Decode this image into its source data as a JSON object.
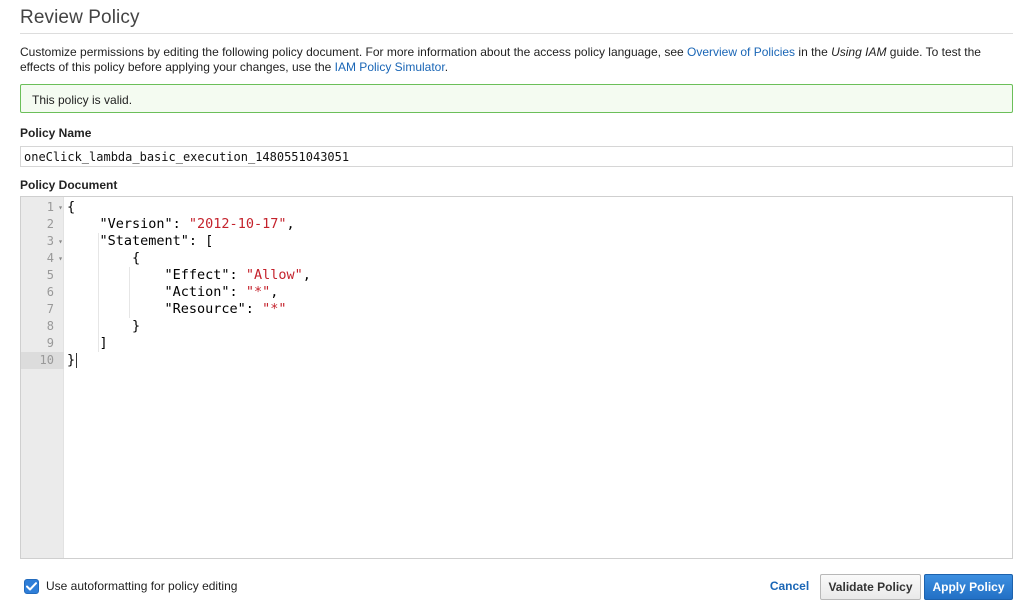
{
  "page": {
    "title": "Review Policy",
    "description": {
      "part1": "Customize permissions by editing the following policy document. For more information about the access policy language, see ",
      "link1": "Overview of Policies",
      "part2": " in the ",
      "italic": "Using IAM",
      "part3": " guide. To test the effects of this policy before applying your changes, use the ",
      "link2": "IAM Policy Simulator",
      "part4": "."
    },
    "validation_message": "This policy is valid."
  },
  "policy_name": {
    "label": "Policy Name",
    "value": "oneClick_lambda_basic_execution_1480551043051"
  },
  "policy_document": {
    "label": "Policy Document",
    "line_numbers": [
      "1",
      "2",
      "3",
      "4",
      "5",
      "6",
      "7",
      "8",
      "9",
      "10"
    ],
    "foldable_lines": [
      1,
      3,
      4
    ],
    "active_line": 10,
    "lines": [
      {
        "pre": "{",
        "str": "",
        "post": ""
      },
      {
        "pre": "    \"Version\": ",
        "str": "\"2012-10-17\"",
        "post": ","
      },
      {
        "pre": "    \"Statement\": [",
        "str": "",
        "post": ""
      },
      {
        "pre": "        {",
        "str": "",
        "post": ""
      },
      {
        "pre": "            \"Effect\": ",
        "str": "\"Allow\"",
        "post": ","
      },
      {
        "pre": "            \"Action\": ",
        "str": "\"*\"",
        "post": ","
      },
      {
        "pre": "            \"Resource\": ",
        "str": "\"*\"",
        "post": ""
      },
      {
        "pre": "        }",
        "str": "",
        "post": ""
      },
      {
        "pre": "    ]",
        "str": "",
        "post": ""
      },
      {
        "pre": "}",
        "str": "",
        "post": ""
      }
    ]
  },
  "footer": {
    "autoformat_label": "Use autoformatting for policy editing",
    "autoformat_checked": true,
    "cancel_label": "Cancel",
    "validate_label": "Validate Policy",
    "apply_label": "Apply Policy"
  },
  "colors": {
    "link": "#1a66b6",
    "string": "#c4222c",
    "valid_border": "#6bbf59",
    "primary_button": "#2f7ed8"
  }
}
